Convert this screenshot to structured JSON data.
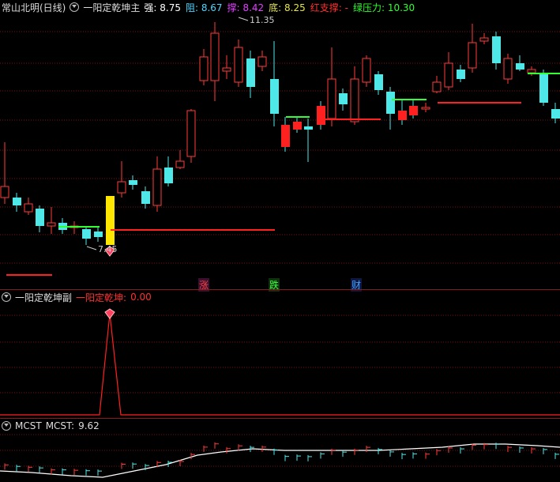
{
  "main": {
    "title": "常山北明(日线)",
    "indicator": "一阳定乾坤主",
    "items": [
      {
        "label": "强:",
        "value": "8.75",
        "color": "#ffffff"
      },
      {
        "label": "阻:",
        "value": "8.67",
        "color": "#4fd6ff"
      },
      {
        "label": "撑:",
        "value": "8.42",
        "color": "#e040ff"
      },
      {
        "label": "底:",
        "value": "8.25",
        "color": "#e6e64a"
      },
      {
        "label": "红支撑:",
        "value": "-",
        "color": "#ff3030"
      },
      {
        "label": "绿压力:",
        "value": "10.30",
        "color": "#30ff30"
      }
    ],
    "high_label": "11.35",
    "low_label": "7.45",
    "signals": {
      "zhang": "涨",
      "die": "跌",
      "cai": "财"
    }
  },
  "sub": {
    "title": "一阳定乾坤副",
    "label": "一阳定乾坤:",
    "value": "0.00"
  },
  "mcst": {
    "name": "MCST",
    "label": "MCST:",
    "value": "9.62"
  },
  "colors": {
    "up": "#ff3a3a",
    "down": "#4fe8e8",
    "grid": "#7a1010",
    "signal": "#ffe600"
  }
}
